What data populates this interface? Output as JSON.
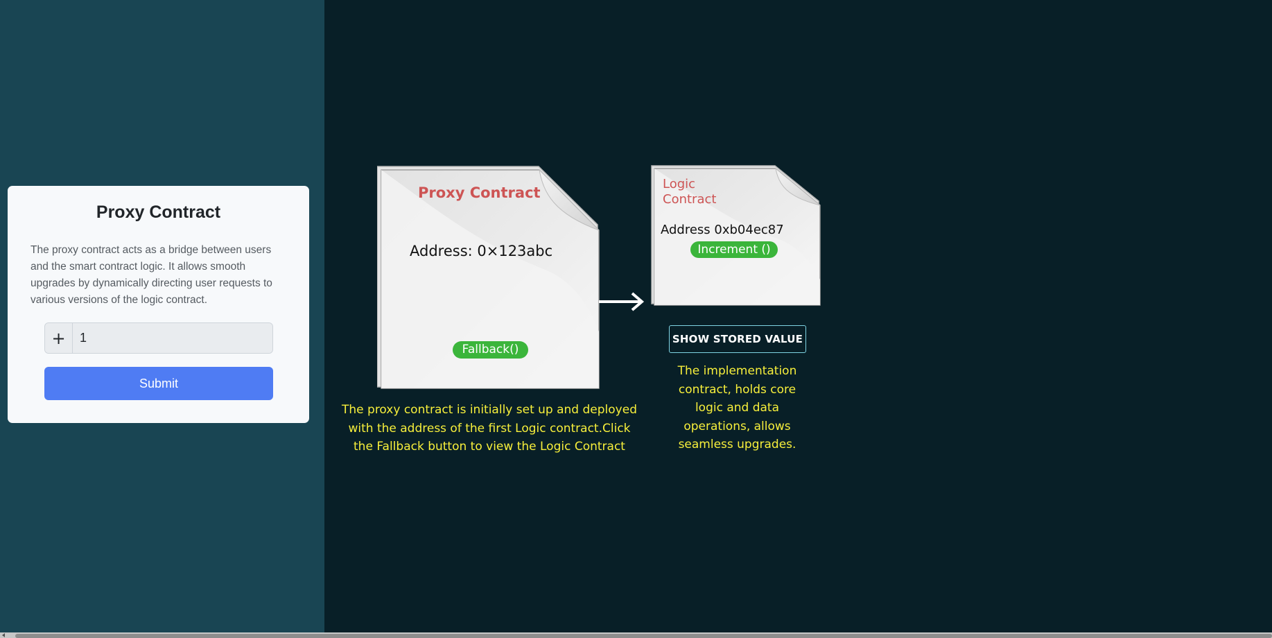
{
  "card": {
    "title": "Proxy Contract",
    "description": "The proxy contract acts as a bridge between users and the smart contract logic. It allows smooth upgrades by dynamically directing user requests to various versions of the logic contract.",
    "input_addon": "+",
    "input_value": "1",
    "submit_label": "Submit"
  },
  "proxy_doc": {
    "title": "Proxy Contract",
    "address": "Address: 0×123abc",
    "fallback_label": "Fallback()",
    "caption": "The proxy contract is initially set up and deployed with the address of the first Logic contract.Click the Fallback button to view the Logic Contract"
  },
  "logic_doc": {
    "title": "Logic Contract",
    "address": "Address 0xb04ec87",
    "increment_label": "Increment ()",
    "show_button_label": "SHOW STORED VALUE",
    "caption": "The implementation contract, holds core logic and data operations, allows seamless upgrades."
  },
  "colors": {
    "left_bg": "#194553",
    "right_bg": "#081f27",
    "accent_blue": "#4f7cf3",
    "pill_green": "#3bb53b",
    "title_red": "#cd5454",
    "caption_yellow": "#f7ef3b"
  }
}
